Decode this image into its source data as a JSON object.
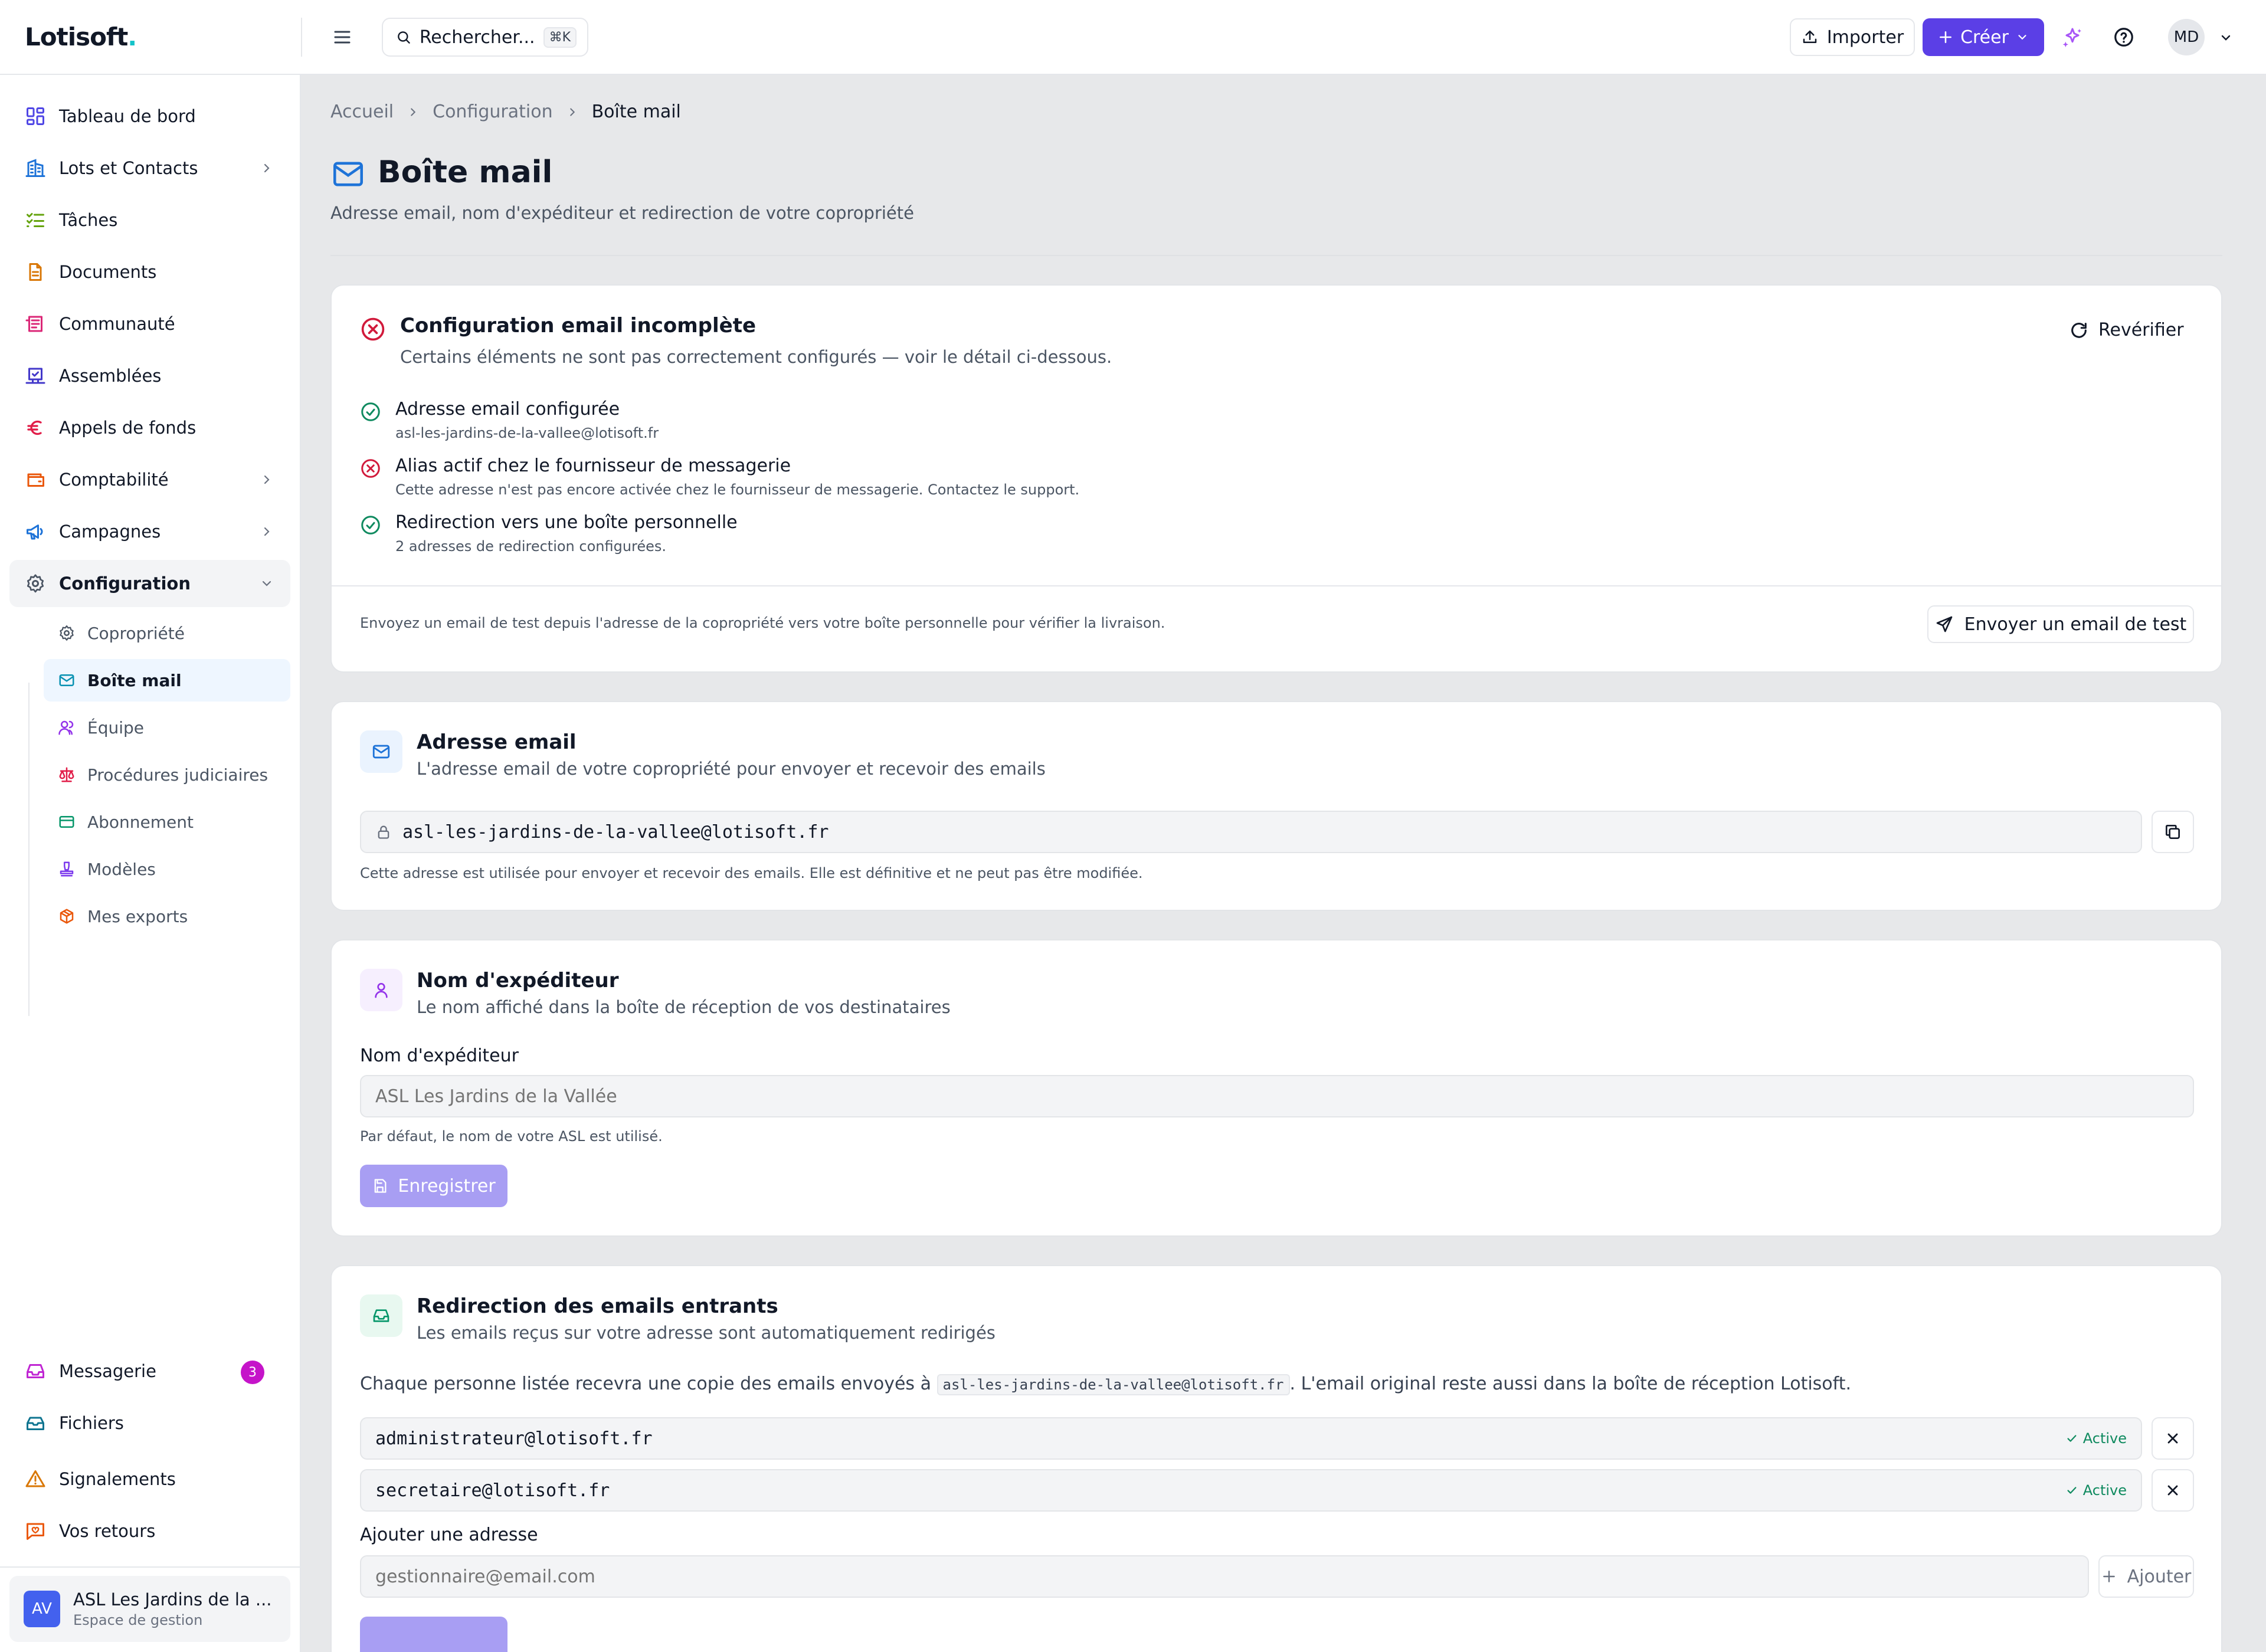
{
  "app": {
    "logo_text": "Lotisoft",
    "logo_dot": "."
  },
  "header": {
    "search_label": "Rechercher...",
    "search_shortcut": "⌘K",
    "import_label": "Importer",
    "create_label": "Créer",
    "user_initials": "MD"
  },
  "sidebar": {
    "items": [
      {
        "label": "Tableau de bord",
        "icon": "dashboard-icon"
      },
      {
        "label": "Lots et Contacts",
        "icon": "building-icon",
        "has_children": true
      },
      {
        "label": "Tâches",
        "icon": "tasks-icon"
      },
      {
        "label": "Documents",
        "icon": "document-icon"
      },
      {
        "label": "Communauté",
        "icon": "newspaper-icon"
      },
      {
        "label": "Assemblées",
        "icon": "assembly-icon"
      },
      {
        "label": "Appels de fonds",
        "icon": "euro-icon"
      },
      {
        "label": "Comptabilité",
        "icon": "wallet-icon",
        "has_children": true
      },
      {
        "label": "Campagnes",
        "icon": "megaphone-icon",
        "has_children": true
      },
      {
        "label": "Configuration",
        "icon": "gear-icon",
        "expanded": true
      }
    ],
    "sub_items": [
      {
        "label": "Copropriété",
        "icon": "gear-small-icon"
      },
      {
        "label": "Boîte mail",
        "icon": "mail-icon",
        "active": true
      },
      {
        "label": "Équipe",
        "icon": "users-icon"
      },
      {
        "label": "Procédures judiciaires",
        "icon": "scale-icon"
      },
      {
        "label": "Abonnement",
        "icon": "credit-card-icon"
      },
      {
        "label": "Modèles",
        "icon": "stamp-icon"
      },
      {
        "label": "Mes exports",
        "icon": "package-icon"
      }
    ],
    "bottom_items": [
      {
        "label": "Messagerie",
        "icon": "inbox-icon",
        "badge": "3"
      },
      {
        "label": "Fichiers",
        "icon": "archive-icon"
      },
      {
        "label": "Signalements",
        "icon": "warning-icon"
      },
      {
        "label": "Vos retours",
        "icon": "feedback-icon"
      }
    ],
    "org": {
      "initials": "AV",
      "name": "ASL Les Jardins de la ...",
      "subtitle": "Espace de gestion"
    }
  },
  "breadcrumb": [
    "Accueil",
    "Configuration",
    "Boîte mail"
  ],
  "page": {
    "title": "Boîte mail",
    "subtitle": "Adresse email, nom d'expéditeur et redirection de votre copropriété"
  },
  "status_card": {
    "title": "Configuration email incomplète",
    "subtitle": "Certains éléments ne sont pas correctement configurés — voir le détail ci-dessous.",
    "recheck_label": "Revérifier",
    "checks": [
      {
        "status": "ok",
        "title": "Adresse email configurée",
        "detail": "asl-les-jardins-de-la-vallee@lotisoft.fr"
      },
      {
        "status": "error",
        "title": "Alias actif chez le fournisseur de messagerie",
        "detail": "Cette adresse n'est pas encore activée chez le fournisseur de messagerie. Contactez le support."
      },
      {
        "status": "ok",
        "title": "Redirection vers une boîte personnelle",
        "detail": "2 adresses de redirection configurées."
      }
    ],
    "test_text": "Envoyez un email de test depuis l'adresse de la copropriété vers votre boîte personnelle pour vérifier la livraison.",
    "test_button": "Envoyer un email de test",
    "colors": {
      "error": "#d11a3b",
      "ok": "#0f8a5f"
    }
  },
  "email_card": {
    "title": "Adresse email",
    "subtitle": "L'adresse email de votre copropriété pour envoyer et recevoir des emails",
    "address": "asl-les-jardins-de-la-vallee@lotisoft.fr",
    "help": "Cette adresse est utilisée pour envoyer et recevoir des emails. Elle est définitive et ne peut pas être modifiée."
  },
  "sender_card": {
    "title": "Nom d'expéditeur",
    "subtitle": "Le nom affiché dans la boîte de réception de vos destinataires",
    "field_label": "Nom d'expéditeur",
    "field_placeholder": "ASL Les Jardins de la Vallée",
    "help": "Par défaut, le nom de votre ASL est utilisé.",
    "save_label": "Enregistrer"
  },
  "redirect_card": {
    "title": "Redirection des emails entrants",
    "subtitle": "Les emails reçus sur votre adresse sont automatiquement redirigés",
    "desc_before": "Chaque personne listée recevra une copie des emails envoyés à",
    "desc_code": "asl-les-jardins-de-la-vallee@lotisoft.fr",
    "desc_after": ". L'email original reste aussi dans la boîte de réception Lotisoft.",
    "addresses": [
      {
        "email": "administrateur@lotisoft.fr",
        "status": "Active"
      },
      {
        "email": "secretaire@lotisoft.fr",
        "status": "Active"
      }
    ],
    "add_label": "Ajouter une adresse",
    "add_placeholder": "gestionnaire@email.com",
    "add_button": "Ajouter"
  },
  "colors": {
    "accent": "#5b3fe6",
    "primary_blue": "#1e73d8",
    "success": "#0f8a5f",
    "danger": "#d11a3b"
  }
}
